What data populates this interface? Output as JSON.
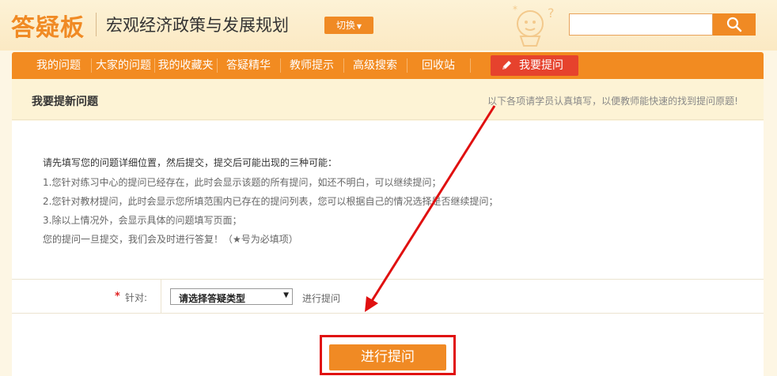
{
  "header": {
    "logo": "答疑板",
    "course_title": "宏观经济政策与发展规划",
    "switch_label": "切换",
    "search": {
      "value": "",
      "placeholder": ""
    }
  },
  "nav": {
    "items": [
      {
        "label": "我的问题"
      },
      {
        "label": "大家的问题"
      },
      {
        "label": "我的收藏夹"
      },
      {
        "label": "答疑精华"
      },
      {
        "label": "教师提示"
      },
      {
        "label": "高级搜索"
      },
      {
        "label": "回收站"
      }
    ],
    "ask_label": "我要提问"
  },
  "title_bar": {
    "title": "我要提新问题",
    "hint": "以下各项请学员认真填写，以便教师能快速的找到提问原题!"
  },
  "instructions": {
    "heading": "请先填写您的问题详细位置，然后提交，提交后可能出现的三种可能：",
    "lines": [
      "1.您针对练习中心的提问已经存在，此时会显示该题的所有提问，如还不明白，可以继续提问；",
      "2.您针对教材提问，此时会显示您所填范围内已存在的提问列表，您可以根据自己的情况选择是否继续提问；",
      "3.除以上情况外，会显示具体的问题填写页面；",
      "您的提问一旦提交，我们会及时进行答复！（★号为必填项）"
    ]
  },
  "form": {
    "required_mark": "*",
    "field_label": "针对:",
    "select_value": "请选择答疑类型",
    "action_text": "进行提问"
  },
  "submit_label": "进行提问",
  "colors": {
    "brand_orange": "#f08a24",
    "ask_red": "#e6422d",
    "annotation_red": "#e01010"
  }
}
